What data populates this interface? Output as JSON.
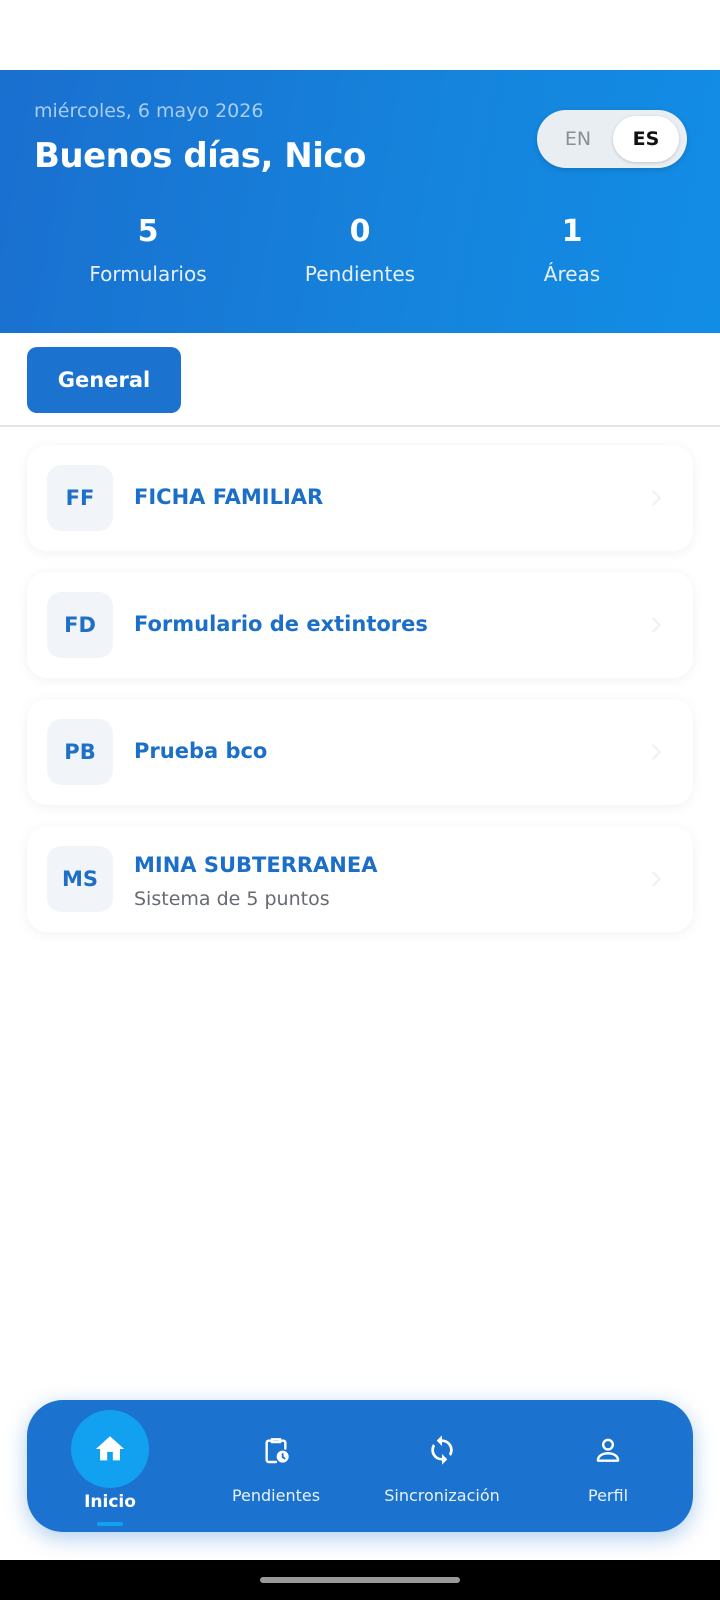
{
  "header": {
    "date": "miércoles, 6 mayo 2026",
    "greeting": "Buenos días, Nico",
    "language": {
      "options": [
        "EN",
        "ES"
      ],
      "selected": "ES"
    },
    "stats": [
      {
        "value": "5",
        "label": "Formularios"
      },
      {
        "value": "0",
        "label": "Pendientes"
      },
      {
        "value": "1",
        "label": "Áreas"
      }
    ]
  },
  "tabs": {
    "active": "General"
  },
  "forms": [
    {
      "initials": "FF",
      "title": "FICHA FAMILIAR",
      "subtitle": ""
    },
    {
      "initials": "FD",
      "title": "Formulario de extintores",
      "subtitle": ""
    },
    {
      "initials": "PB",
      "title": "Prueba bco",
      "subtitle": ""
    },
    {
      "initials": "MS",
      "title": "MINA SUBTERRANEA",
      "subtitle": "Sistema de 5 puntos"
    }
  ],
  "nav": {
    "items": [
      {
        "label": "Inicio",
        "icon": "home-icon",
        "active": true
      },
      {
        "label": "Pendientes",
        "icon": "clipboard-clock-icon",
        "active": false
      },
      {
        "label": "Sincronización",
        "icon": "sync-icon",
        "active": false
      },
      {
        "label": "Perfil",
        "icon": "person-icon",
        "active": false
      }
    ]
  },
  "colors": {
    "primary": "#1c72cf",
    "accent": "#12a0f0",
    "card_title": "#1c6fc8"
  }
}
